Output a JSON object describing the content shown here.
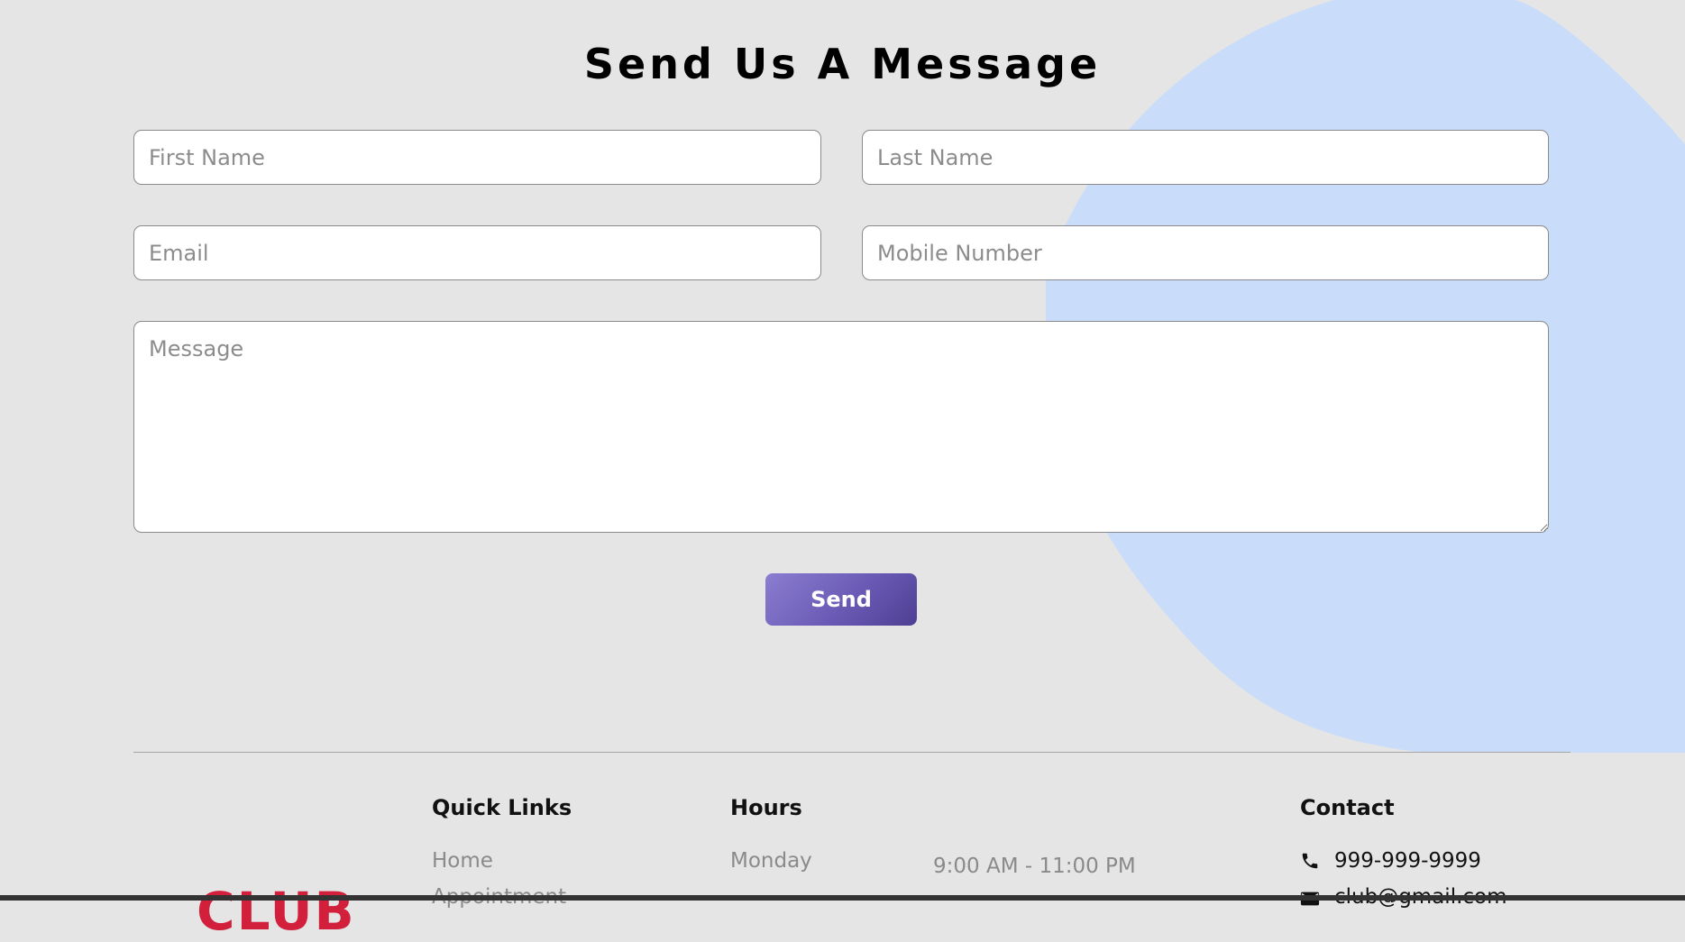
{
  "form": {
    "heading": "Send Us A Message",
    "first_name_placeholder": "First Name",
    "last_name_placeholder": "Last Name",
    "email_placeholder": "Email",
    "mobile_placeholder": "Mobile Number",
    "message_placeholder": "Message",
    "send_label": "Send"
  },
  "footer": {
    "logo_text": "CLUB",
    "quick_links": {
      "title": "Quick Links",
      "items": [
        "Home",
        "Appointment"
      ]
    },
    "hours": {
      "title": "Hours",
      "rows": [
        {
          "day": "Monday",
          "time": "9:00 AM - 11:00 PM"
        }
      ]
    },
    "contact": {
      "title": "Contact",
      "phone": "999-999-9999",
      "email": "club@gmail.com",
      "phone_icon": "phone-icon",
      "email_icon": "envelope-icon"
    }
  },
  "colors": {
    "background": "#e5e5e5",
    "blob": "#c9dcf9",
    "button_gradient_start": "#8b7dd0",
    "button_gradient_end": "#4e3f93",
    "logo": "#d21f3c"
  }
}
